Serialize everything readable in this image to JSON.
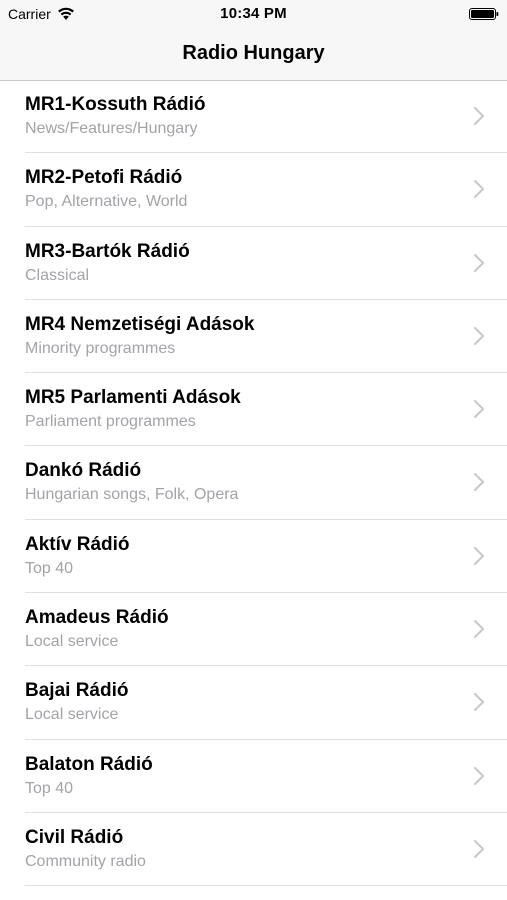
{
  "status_bar": {
    "carrier": "Carrier",
    "time": "10:34 PM",
    "icons": [
      "wifi-icon",
      "battery-icon"
    ]
  },
  "nav": {
    "title": "Radio Hungary"
  },
  "colors": {
    "bar_background": "#f7f7f7",
    "subtitle": "#a3a3a8",
    "chevron": "#c7c7cc",
    "separator": "#e0e0e4"
  },
  "stations": [
    {
      "name": "MR1-Kossuth Rádió",
      "genre": "News/Features/Hungary"
    },
    {
      "name": "MR2-Petofi Rádió",
      "genre": "Pop, Alternative, World"
    },
    {
      "name": "MR3-Bartók Rádió",
      "genre": "Classical"
    },
    {
      "name": "MR4 Nemzetiségi Adások",
      "genre": "Minority programmes"
    },
    {
      "name": "MR5 Parlamenti Adások",
      "genre": "Parliament programmes"
    },
    {
      "name": "Dankó Rádió",
      "genre": "Hungarian songs, Folk, Opera"
    },
    {
      "name": "Aktív Rádió",
      "genre": "Top 40"
    },
    {
      "name": "Amadeus Rádió",
      "genre": "Local service"
    },
    {
      "name": "Bajai Rádió",
      "genre": "Local service"
    },
    {
      "name": "Balaton Rádió",
      "genre": "Top 40"
    },
    {
      "name": "Civil Rádió",
      "genre": "Community radio"
    }
  ]
}
